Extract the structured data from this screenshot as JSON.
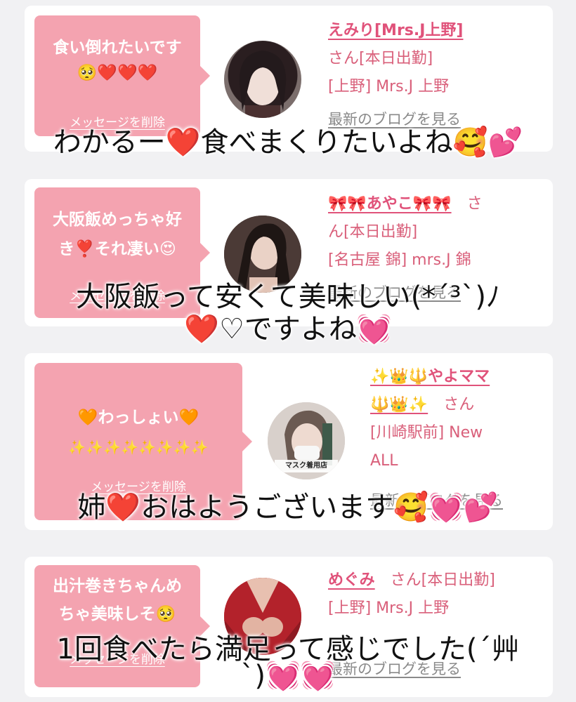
{
  "cards": [
    {
      "message": "食い倒れたいです",
      "message_emoji": "🥺❤️❤️❤️",
      "delete_label": "メッセージを削除",
      "name": "えみり[Mrs.J上野]",
      "san": "さん[本日出勤]",
      "shop": "[上野] Mrs.J 上野",
      "blog_label": "最新のブログを見る"
    },
    {
      "message": "大阪飯めっちゃ好",
      "message_emoji": "き❣️それ凄い😍",
      "delete_label": "メッセージを削除",
      "name": "🎀🎀あやこ🎀🎀",
      "san": "さ",
      "san_line2": "ん[本日出勤]",
      "shop": "[名古屋 錦] mrs.J 錦",
      "blog_label": "最新のブログを見る"
    },
    {
      "message": "🧡わっしょい🧡",
      "message_emoji": "✨✨✨✨✨✨✨✨",
      "delete_label": "メッセージを削除",
      "name": "✨👑🔱やよママ",
      "name_line2": "🔱👑✨",
      "san": "さん",
      "shop": "[川崎駅前] New",
      "shop_line2": "ALL",
      "avatar_caption": "マスク着用店",
      "blog_label": "最新のブログを見る"
    },
    {
      "message": "出汁巻きちゃんめ",
      "message_emoji": "ちゃ美味しそ🥺",
      "delete_label": "メッセージを削除",
      "name": "めぐみ",
      "san": "さん[本日出勤]",
      "shop": "[上野] Mrs.J 上野",
      "blog_label": "最新のブログを見る"
    }
  ],
  "overlays": [
    {
      "line1": "わかるー❤️食べまくりたいよね🥰💕"
    },
    {
      "line1": "大阪飯って安くて美味しい(*´³`)ﾉ",
      "line2": "❤️♡ですよね💓"
    },
    {
      "line1": "姉❤️おはようございます🥰💓💕"
    },
    {
      "line1": "1回食べたら満足って感じでした(´艸",
      "line2": "`)💓💓"
    }
  ],
  "colors": {
    "background": "#f1f1f3",
    "bubble": "#f4a3b0",
    "name": "#e0527a",
    "info": "#d95f7a",
    "blog": "#8a8a8a"
  }
}
